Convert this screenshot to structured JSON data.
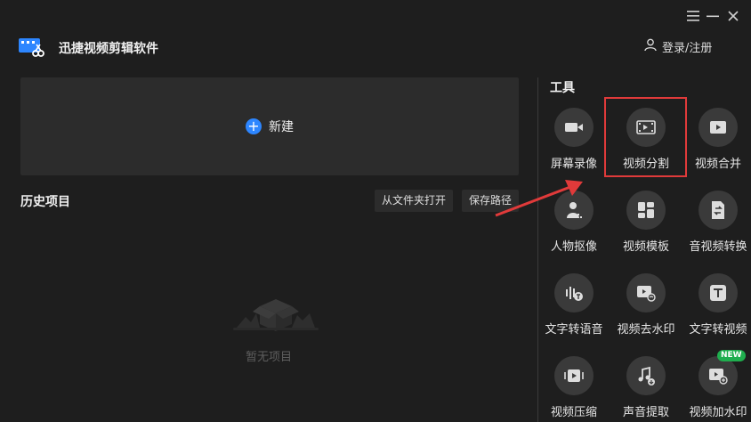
{
  "app": {
    "title": "迅捷视频剪辑软件"
  },
  "window_controls": {
    "menu_icon": "menu-icon",
    "minimize_icon": "minimize-icon",
    "close_icon": "close-icon"
  },
  "header": {
    "login_label": "登录/注册"
  },
  "new_project": {
    "label": "新建"
  },
  "history": {
    "title": "历史项目",
    "open_folder_label": "从文件夹打开",
    "save_path_label": "保存路径",
    "empty_label": "暂无项目"
  },
  "tools": {
    "title": "工具",
    "items": [
      {
        "label": "屏幕录像",
        "icon": "screen-record-icon"
      },
      {
        "label": "视频分割",
        "icon": "video-split-icon",
        "highlighted": true
      },
      {
        "label": "视频合并",
        "icon": "video-merge-icon"
      },
      {
        "label": "人物抠像",
        "icon": "person-cutout-icon"
      },
      {
        "label": "视频模板",
        "icon": "video-template-icon"
      },
      {
        "label": "音视频转换",
        "icon": "av-convert-icon"
      },
      {
        "label": "文字转语音",
        "icon": "text-to-speech-icon"
      },
      {
        "label": "视频去水印",
        "icon": "remove-watermark-icon"
      },
      {
        "label": "文字转视频",
        "icon": "text-to-video-icon"
      },
      {
        "label": "视频压缩",
        "icon": "video-compress-icon"
      },
      {
        "label": "声音提取",
        "icon": "audio-extract-icon"
      },
      {
        "label": "视频加水印",
        "icon": "add-watermark-icon",
        "badge": "NEW"
      }
    ]
  },
  "colors": {
    "accent": "#2d86ff",
    "highlight": "#e03a3a",
    "arrow": "#e03a3a",
    "badge": "#1fae4e"
  }
}
